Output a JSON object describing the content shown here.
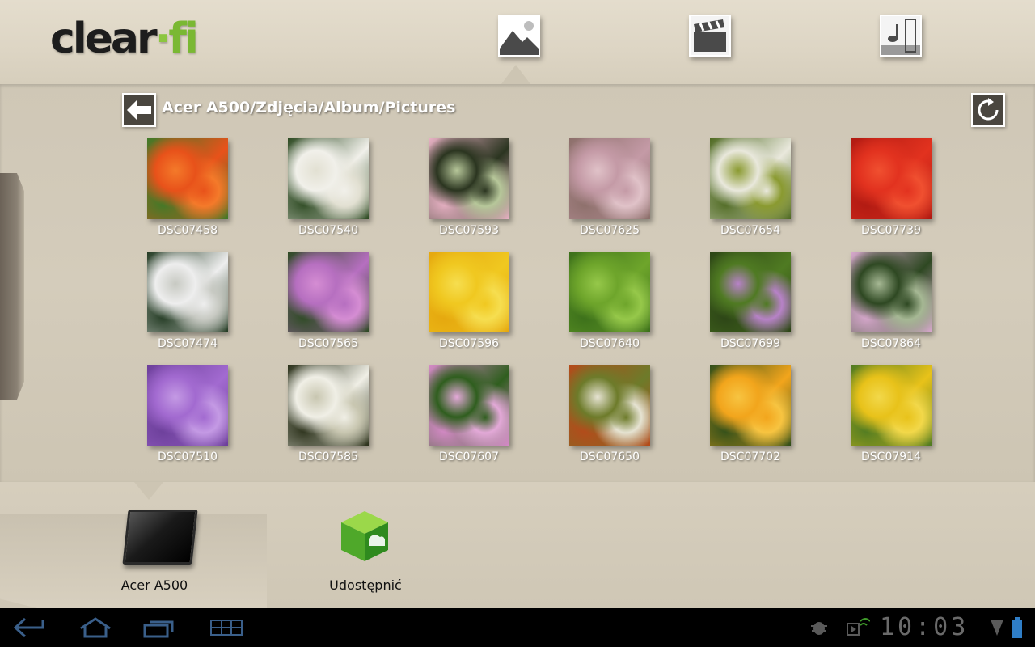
{
  "app": {
    "logo": {
      "main": "clear",
      "dot": "·",
      "accent": "fi"
    }
  },
  "media_tabs": [
    {
      "name": "photos",
      "icon": "photo-icon",
      "active": true
    },
    {
      "name": "video",
      "icon": "clapperboard-icon",
      "active": false
    },
    {
      "name": "music",
      "icon": "music-note-icon",
      "active": false
    }
  ],
  "browser": {
    "path": "Acer A500/Zdjęcia/Album/Pictures",
    "items": [
      {
        "label": "DSC07458",
        "colors": [
          "#e8521a",
          "#3f7a28",
          "#f47a2a"
        ]
      },
      {
        "label": "DSC07540",
        "colors": [
          "#f1f0ea",
          "#2d4a22",
          "#e2e0d2"
        ]
      },
      {
        "label": "DSC07593",
        "colors": [
          "#2b3520",
          "#e9b2c5",
          "#b7c79a"
        ]
      },
      {
        "label": "DSC07625",
        "colors": [
          "#c49aa6",
          "#8c6f6a",
          "#e0c2c8"
        ]
      },
      {
        "label": "DSC07654",
        "colors": [
          "#e9e8dc",
          "#4f6a22",
          "#8a9a30"
        ]
      },
      {
        "label": "DSC07739",
        "colors": [
          "#e2321f",
          "#b01a12",
          "#f05030"
        ]
      },
      {
        "label": "DSC07474",
        "colors": [
          "#eeeeee",
          "#223a22",
          "#c7c9c2"
        ]
      },
      {
        "label": "DSC07565",
        "colors": [
          "#b66fc0",
          "#2c4a22",
          "#d58dd3"
        ]
      },
      {
        "label": "DSC07596",
        "colors": [
          "#f0c820",
          "#e5a70e",
          "#f6de50"
        ]
      },
      {
        "label": "DSC07640",
        "colors": [
          "#6ea52b",
          "#3b6f1a",
          "#96c84a"
        ]
      },
      {
        "label": "DSC07699",
        "colors": [
          "#4f7a22",
          "#2c4416",
          "#b782c7"
        ]
      },
      {
        "label": "DSC07864",
        "colors": [
          "#2e4822",
          "#d9a9cf",
          "#a6b894"
        ]
      },
      {
        "label": "DSC07510",
        "colors": [
          "#a26ad0",
          "#6c3f9a",
          "#c49ae4"
        ]
      },
      {
        "label": "DSC07585",
        "colors": [
          "#f0efe6",
          "#2a3019",
          "#c8c6b0"
        ]
      },
      {
        "label": "DSC07607",
        "colors": [
          "#2f5e1e",
          "#d78ac9",
          "#e3a9d8"
        ]
      },
      {
        "label": "DSC07650",
        "colors": [
          "#6d7b2a",
          "#b54a1a",
          "#e6e3d2"
        ]
      },
      {
        "label": "DSC07702",
        "colors": [
          "#f2a51c",
          "#2f4e1a",
          "#f7c441"
        ]
      },
      {
        "label": "DSC07914",
        "colors": [
          "#e8c21a",
          "#4e7a22",
          "#f2d84a"
        ]
      }
    ]
  },
  "devices": [
    {
      "label": "Acer A500",
      "icon": "tablet-device-icon"
    },
    {
      "label": "Udostępnić",
      "icon": "share-cube-icon"
    }
  ],
  "system_bar": {
    "time": "10:03",
    "buttons": [
      "back-icon",
      "home-icon",
      "recent-apps-icon",
      "menu-grid-icon"
    ]
  },
  "colors": {
    "accent_green": "#7ab833",
    "panel": "#cfc7b6",
    "system_bar": "#000000"
  }
}
